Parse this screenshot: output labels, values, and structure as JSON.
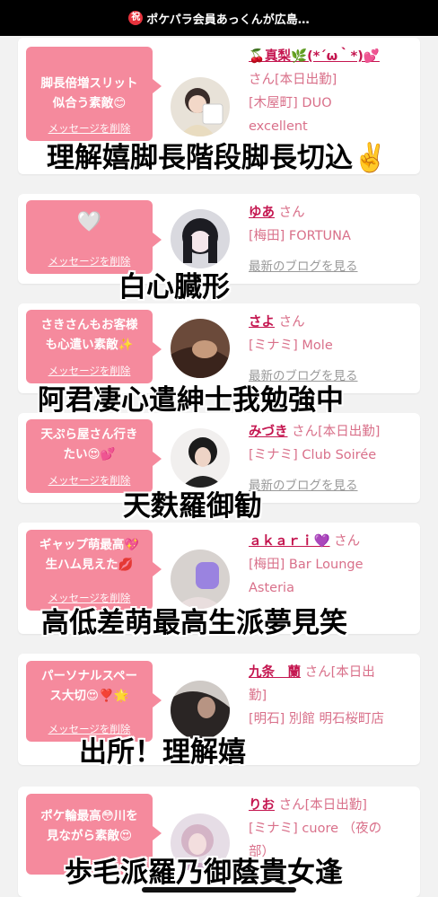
{
  "status_bar": {
    "badge": "祝",
    "title": "ポケパラ会員あっくんが広島…"
  },
  "delete_label": "メッセージを削除",
  "blog_label": "最新のブログを見る",
  "san_label": "さん",
  "cards": [
    {
      "message": "脚長倍増スリット\n似合う素敵😊",
      "name": "🍒真梨🌿(*´ω｀*)💕",
      "san": "さん[本日出勤]",
      "line2": "[木屋町] DUO",
      "line3": "excellent",
      "caption": "理解嬉脚長階段脚長切込✌️"
    },
    {
      "message": "🤍",
      "name": "ゆあ",
      "san": "さん",
      "line2": "[梅田] FORTUNA",
      "caption": "白心臓形"
    },
    {
      "message": "さきさんもお客様\nも心遣い素敵✨",
      "name": "さよ",
      "san": "さん",
      "line2": "[ミナミ] Mole",
      "caption": "阿君凄心遣紳士我勉強中"
    },
    {
      "message": "天ぷら屋さん行き\nたい😍💕",
      "name": "みづき",
      "san": "さん[本日出勤]",
      "line2": "[ミナミ] Club Soirée",
      "caption": "天麩羅御勧"
    },
    {
      "message": "ギャップ萌最高💖\n生ハム見えた💋",
      "name": "ａｋａｒｉ💜",
      "san": "さん",
      "line2": "[梅田] Bar Lounge",
      "line3": "Asteria",
      "caption": "高低差萌最高生派夢見笑"
    },
    {
      "message": "パーソナルスペー\nス大切😍❣️🌟",
      "name": "九条　蘭",
      "san": "さん[本日出",
      "line2b": "勤]",
      "line2": "[明石] 別館 明石桜町店",
      "caption": "出所！理解嬉"
    },
    {
      "message": "ポケ輪最高😳川を\n見ながら素敵😍",
      "name": "りお",
      "san": "さん[本日出勤]",
      "line2": "[ミナミ] cuore （夜の",
      "line3": "部）",
      "caption": "歩毛派羅乃御蔭貴女逢"
    }
  ]
}
